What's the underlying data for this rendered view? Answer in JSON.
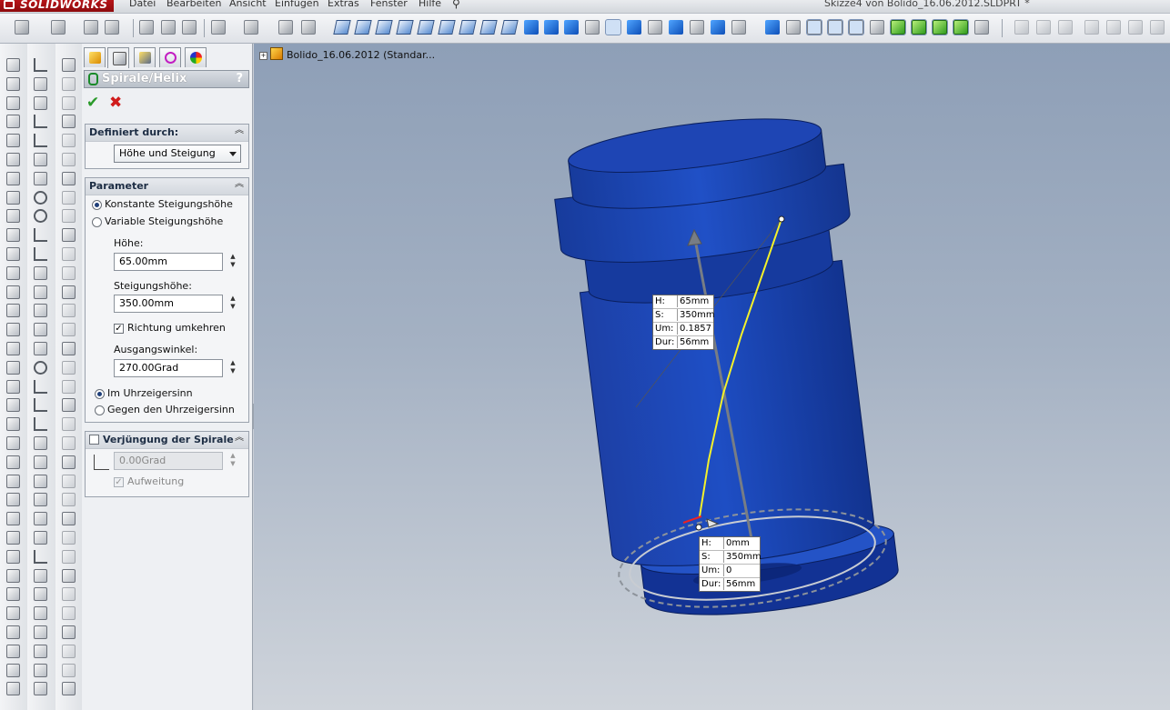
{
  "app": {
    "logo": "SOLIDWORKS",
    "document_title": "Skizze4 von Bolido_16.06.2012.SLDPRT *"
  },
  "menu": [
    "Datei",
    "Bearbeiten",
    "Ansicht",
    "Einfügen",
    "Extras",
    "Fenster",
    "Hilfe"
  ],
  "colors": {
    "part": "#1c46b8",
    "part_dark": "#0d2a85",
    "helix": "#f4f12a",
    "accent_header": "#b9c0c9"
  },
  "property_manager": {
    "title": "Spirale/Helix",
    "help": "?",
    "tabs": [
      "feature-manager-icon",
      "property-manager-icon",
      "configuration-manager-icon",
      "dimxpert-icon",
      "display-manager-icon"
    ],
    "defined_by": {
      "title": "Definiert durch:",
      "value": "Höhe und Steigung"
    },
    "parameters": {
      "title": "Parameter",
      "option_constant": "Konstante Steigungshöhe",
      "option_variable": "Variable Steigungshöhe",
      "height_label": "Höhe:",
      "height_value": "65.00mm",
      "pitch_label": "Steigungshöhe:",
      "pitch_value": "350.00mm",
      "reverse_label": "Richtung umkehren",
      "start_angle_label": "Ausgangswinkel:",
      "start_angle_value": "270.00Grad",
      "clockwise": "Im Uhrzeigersinn",
      "counterclockwise": "Gegen den Uhrzeigersinn"
    },
    "taper": {
      "title": "Verjüngung der Spirale",
      "angle_value": "0.00Grad",
      "flare_label": "Aufweitung"
    }
  },
  "viewport": {
    "tree_item": "Bolido_16.06.2012  (Standar...",
    "callout_top": [
      {
        "k": "H:",
        "v": "65mm"
      },
      {
        "k": "S:",
        "v": "350mm"
      },
      {
        "k": "Um:",
        "v": "0.1857"
      },
      {
        "k": "Dur:",
        "v": "56mm"
      }
    ],
    "callout_bottom": [
      {
        "k": "H:",
        "v": "0mm"
      },
      {
        "k": "S:",
        "v": "350mm"
      },
      {
        "k": "Um:",
        "v": "0"
      },
      {
        "k": "Dur:",
        "v": "56mm"
      }
    ]
  }
}
